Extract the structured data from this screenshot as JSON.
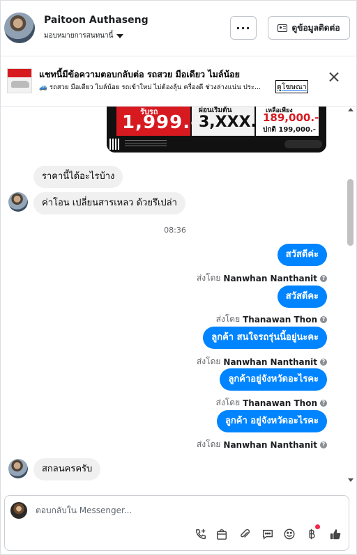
{
  "header": {
    "name": "Paitoon Authaseng",
    "assign_label": "มอบหมายการสนทนานี้",
    "more_label": "···",
    "contact_label": "ดูข้อมูลติดต่อ"
  },
  "banner": {
    "title": "แชทนี้มีข้อความตอบกลับต่อ รถสวย มือเดียว ไมล์น้อย",
    "text": "🚙 รถสวย มือเดียว ไมล์น้อย รถเข้าใหม่ ไม่ต้องลุ้น ครื่องดี ช่วงล่างแน่น ประ...",
    "link": "ดูโฆษณา"
  },
  "ad_image": {
    "red_small": "รับรถ",
    "red_big": "1,999.-",
    "mid_small": "ผ่อนเริ่มต้น",
    "mid_big": "3,XXX.-",
    "right_l1": "เหลือเพียง",
    "right_l2": "189,000.-",
    "right_l3": "ปกติ 199,000.-"
  },
  "messages": [
    {
      "dir": "in",
      "text": "ราคานี้ได้อะไรบ้าง"
    },
    {
      "dir": "in",
      "text": "ค่าโอน เปลี่ยนสารเหลว ด้วยรึเปล่า"
    },
    {
      "dir": "time",
      "text": "08:36"
    },
    {
      "dir": "out",
      "text": "สวัสดีค่ะ",
      "sent_prefix": "ส่งโดย",
      "sender": "Nanwhan Nanthanit"
    },
    {
      "dir": "out",
      "text": "สวัสดีคะ",
      "sent_prefix": "ส่งโดย",
      "sender": "Thanawan Thon"
    },
    {
      "dir": "out",
      "text": "ลูกค้า  สนใจรถรุ่นนี้อยู่นะคะ",
      "sent_prefix": "ส่งโดย",
      "sender": "Nanwhan Nanthanit"
    },
    {
      "dir": "out",
      "text": "ลูกค้าอยู่จังหวัดอะไรคะ",
      "sent_prefix": "ส่งโดย",
      "sender": "Thanawan Thon"
    },
    {
      "dir": "out",
      "text": "ลูกค้า  อยู่จังหวัดอะไรคะ",
      "sent_prefix": "ส่งโดย",
      "sender": "Nanwhan Nanthanit"
    },
    {
      "dir": "in",
      "text": "สกลนครครับ"
    }
  ],
  "composer": {
    "placeholder": "ตอบกลับใน Messenger..."
  },
  "colors": {
    "outgoing_bubble": "#0084ff",
    "incoming_bubble": "#f0f0f0",
    "notification_dot": "#f02849"
  },
  "icons": [
    "call-add-icon",
    "shop-bag-icon",
    "paperclip-icon",
    "quick-reply-icon",
    "emoji-icon",
    "baht-icon",
    "thumbs-up-icon"
  ]
}
